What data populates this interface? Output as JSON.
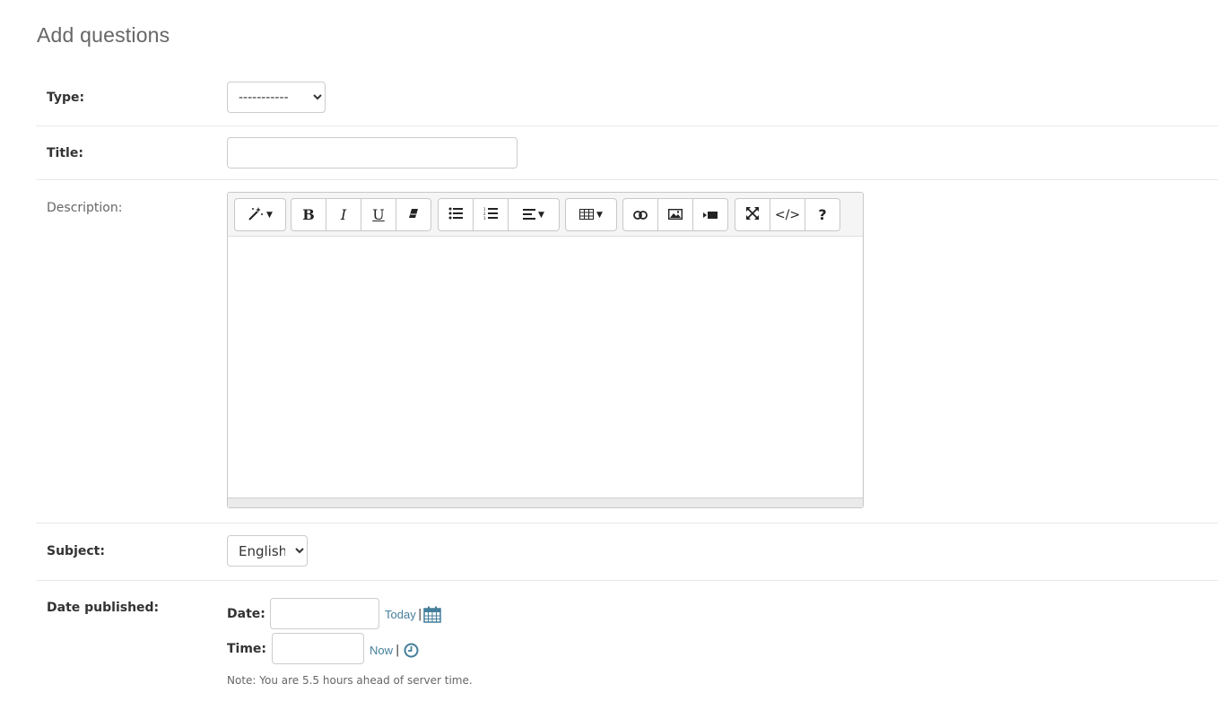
{
  "page": {
    "title": "Add questions"
  },
  "form": {
    "type": {
      "label": "Type:",
      "value": "-----------"
    },
    "title": {
      "label": "Title:",
      "value": ""
    },
    "description": {
      "label": "Description:",
      "toolbar": {
        "style": "✨",
        "bold": "B",
        "italic": "I",
        "underline": "U",
        "clear": "⌫",
        "ul": "≔",
        "ol": "⒈",
        "align": "≡",
        "table": "▦",
        "link": "🔗",
        "picture": "🖼",
        "video": "▶",
        "fullscreen": "⤢",
        "codeview": "</>",
        "help": "?"
      }
    },
    "subject": {
      "label": "Subject:",
      "value": "English"
    },
    "date_published": {
      "label": "Date published:",
      "date_label": "Date:",
      "time_label": "Time:",
      "today_link": "Today",
      "now_link": "Now",
      "separator": "|",
      "note": "Note: You are 5.5 hours ahead of server time."
    }
  },
  "colors": {
    "link": "#447e9b",
    "border": "#cccccc"
  }
}
